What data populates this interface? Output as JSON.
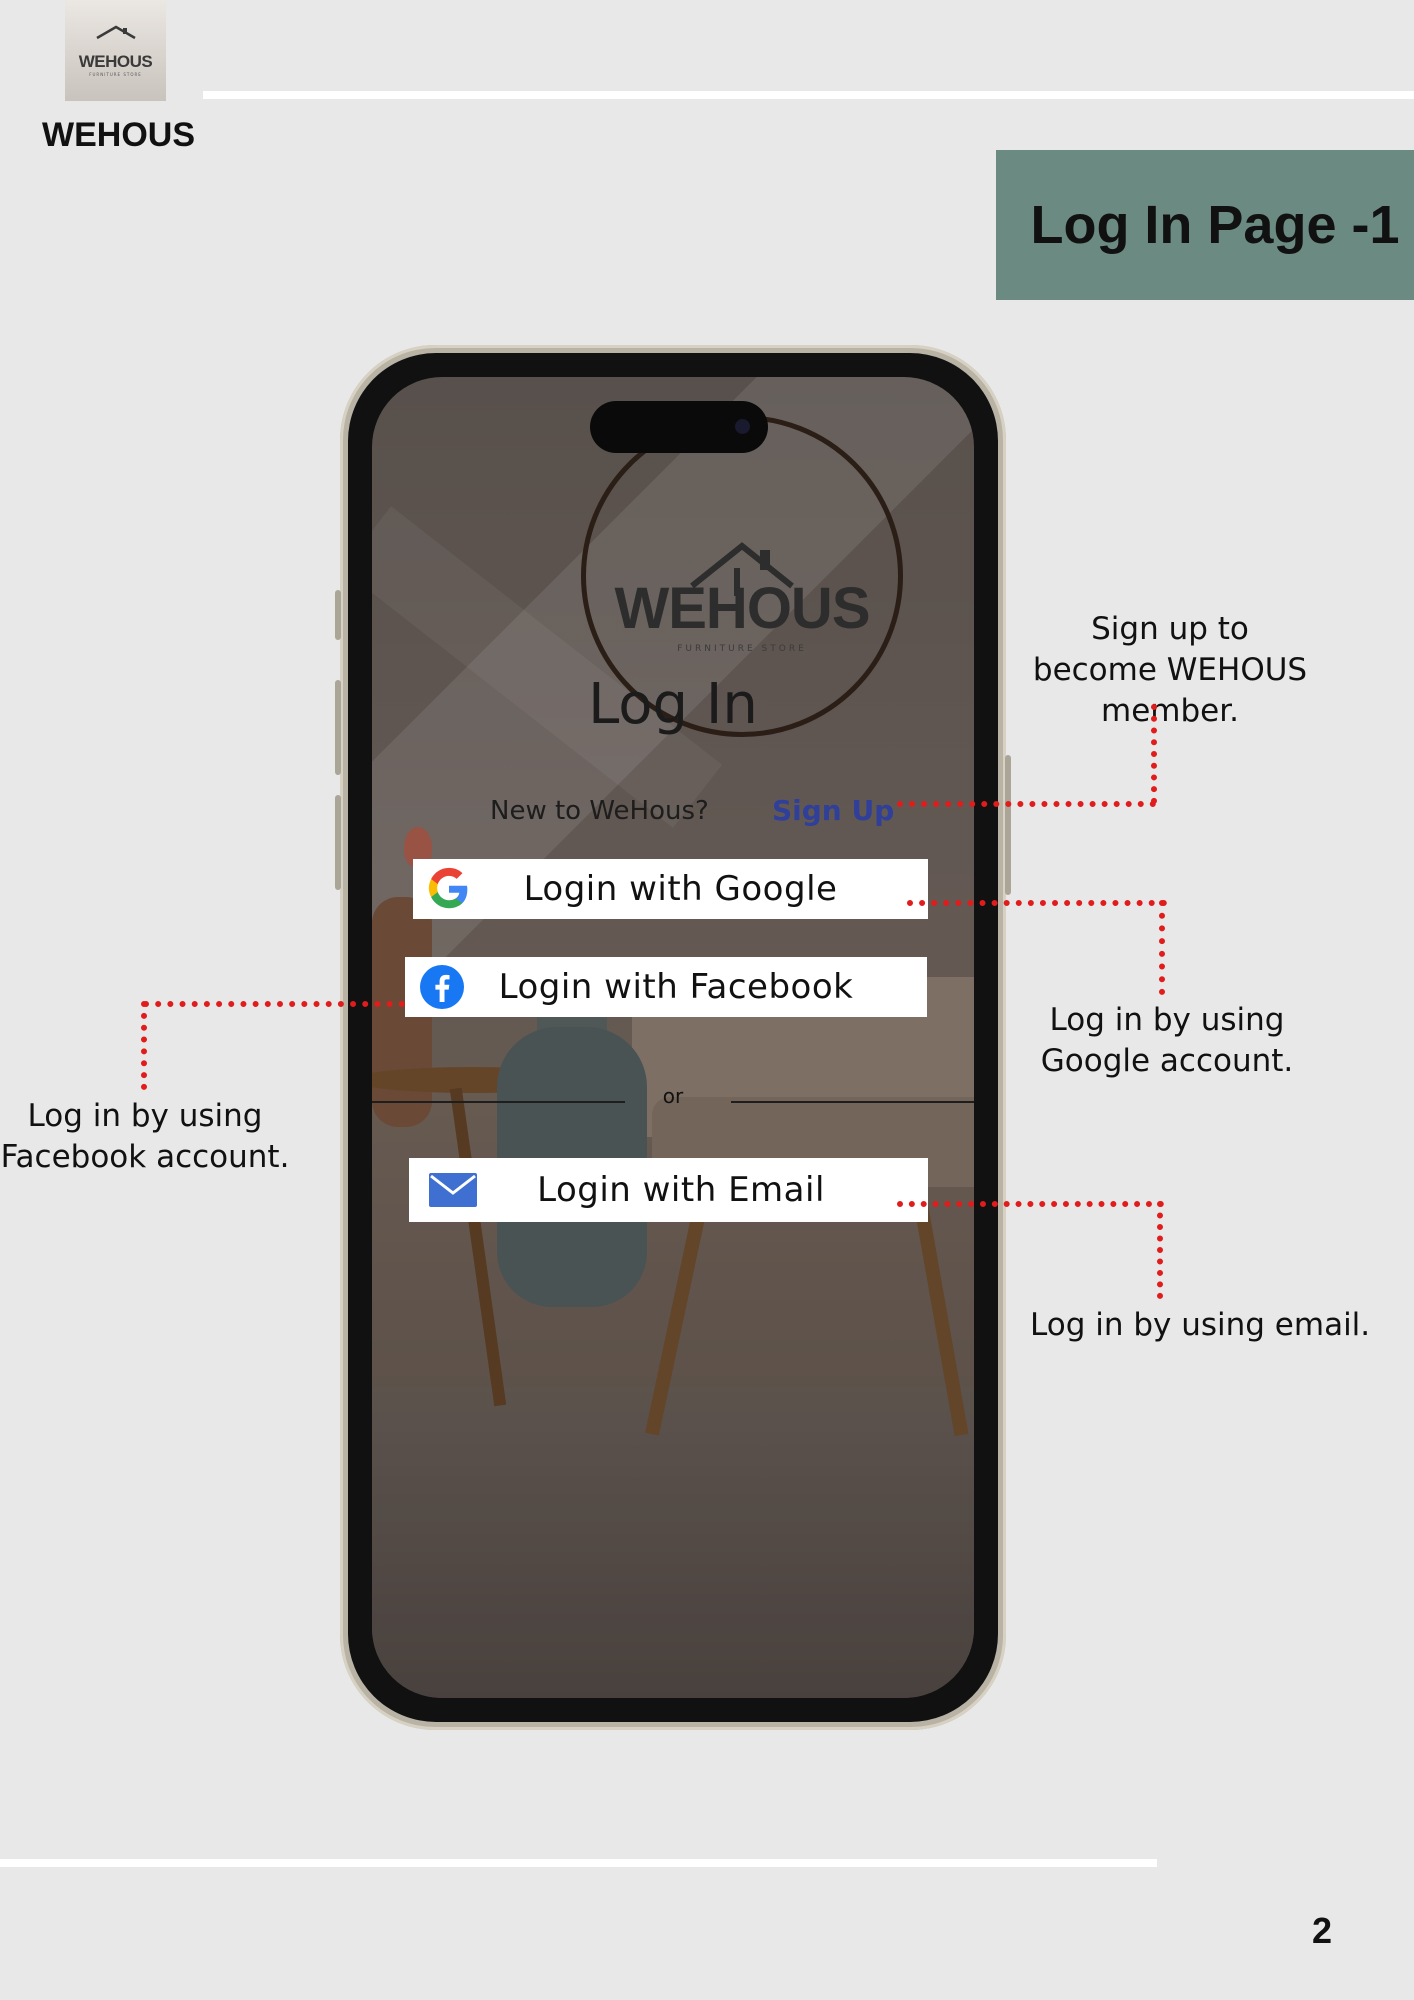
{
  "header": {
    "logo_text": "WEHOUS",
    "logo_sub": "FURNITURE STORE",
    "brand_name": "WEHOUS",
    "page_title": "Log In Page -1"
  },
  "phone": {
    "logo_word": "WEHOUS",
    "logo_sub": "FURNITURE STORE",
    "title": "Log In",
    "new_prompt": "New to WeHous?",
    "signup_link": "Sign Up",
    "google_button": "Login with Google",
    "facebook_button": "Login with Facebook",
    "or_text": "or",
    "email_button": "Login with Email"
  },
  "callouts": {
    "signup": "Sign up to become WEHOUS member.",
    "google": "Log in by using Google account.",
    "facebook": "Log in by using Facebook account.",
    "email": "Log in by using email."
  },
  "footer": {
    "page_number": "2"
  },
  "colors": {
    "background": "#e8e8e8",
    "title_box": "#6a8a82",
    "callout_line": "#e01c1c",
    "signup_link": "#2f3f9a",
    "facebook_blue": "#1877f2",
    "email_icon": "#3f6fd1"
  },
  "icons": [
    "house-logo-icon",
    "google-icon",
    "facebook-icon",
    "mail-icon"
  ]
}
